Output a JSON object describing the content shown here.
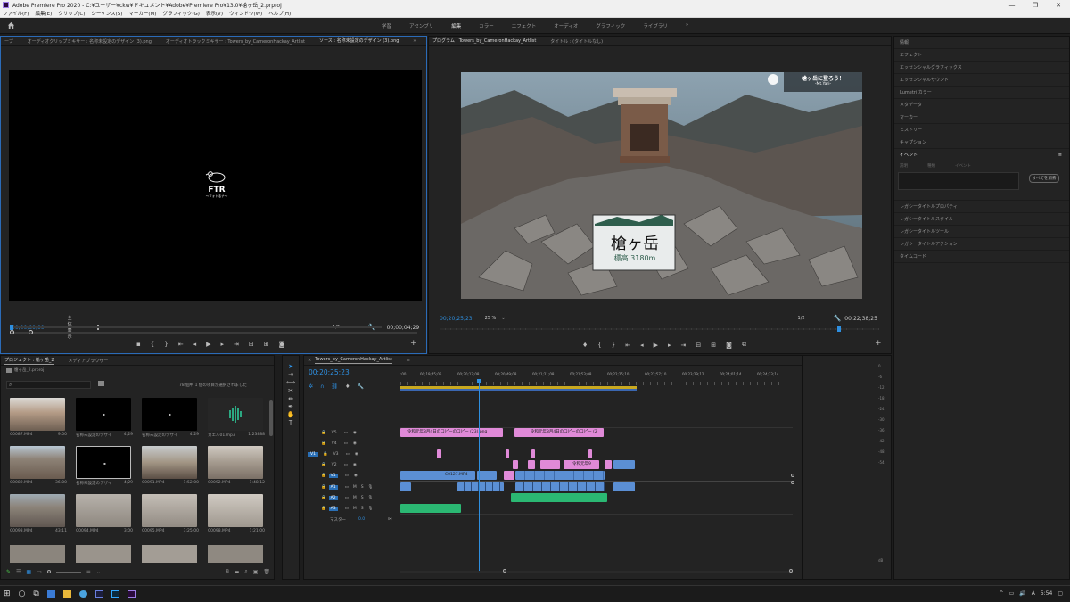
{
  "window": {
    "title": "Adobe Premiere Pro 2020 - C:¥ユーザー¥ckw¥ドキュメント¥Adobe¥Premiere Pro¥13.0¥槍ヶ岳_2.prproj",
    "minimize": "—",
    "maximize": "❐",
    "close": "✕"
  },
  "menu": [
    "ファイル(F)",
    "編集(E)",
    "クリップ(C)",
    "シーケンス(S)",
    "マーカー(M)",
    "グラフィック(G)",
    "表示(V)",
    "ウィンドウ(W)",
    "ヘルプ(H)"
  ],
  "workspace": {
    "tabs": [
      "学習",
      "アセンブリ",
      "編集",
      "カラー",
      "エフェクト",
      "オーディオ",
      "グラフィック",
      "ライブラリ"
    ],
    "active": "編集",
    "more": "»"
  },
  "source": {
    "tabs": [
      "ープ",
      "オーディオクリップミキサー : 名称未設定のデザイン (3).png",
      "オーディオトラックミキサー : Towers_by_CameronHackay_Artlist",
      "ソース : 名称未設定のデザイン (3).png"
    ],
    "expand": "»",
    "logo_text": "FTR",
    "logo_sub": "〜フォトるナ〜",
    "timecode_in": "00;00;00;00",
    "fit": "全体表示",
    "ratio": "1/2",
    "duration": "00;00;04;29"
  },
  "program": {
    "tabs": [
      "プログラム : Towers_by_CameronHackay_Artlist",
      "タイトル : (タイトルなし)"
    ],
    "sign_name": "槍ヶ岳",
    "sign_sub": "標高 3180m",
    "overlay_title": "槍ヶ岳に登ろう！",
    "overlay_sub": "-Mt.Yari-",
    "timecode": "00;20;25;23",
    "zoom": "25 %",
    "ratio": "1/2",
    "duration": "00;22;38;25"
  },
  "right_panel": {
    "items": [
      "情報",
      "エフェクト",
      "エッセンシャルグラフィックス",
      "エッセンシャルサウンド",
      "Lumetri カラー",
      "メタデータ",
      "マーカー",
      "ヒストリー",
      "キャプション",
      "イベント"
    ],
    "events_cols": [
      "説明",
      "種類",
      "イベント"
    ],
    "clear_all": "すべてを消去",
    "legacy": [
      "レガシータイトルプロパティ",
      "レガシータイトルスタイル",
      "レガシータイトルツール",
      "レガシータイトルアクション",
      "タイムコード"
    ]
  },
  "project": {
    "tabs": [
      "プロジェクト : 槍ヶ岳_2",
      "メディアブラウザー"
    ],
    "file": "槍ヶ岳_2.prproj",
    "status": "78 個中 1 個の項目が選択されました",
    "clips": [
      {
        "name": "C0087.MP4",
        "dur": "9:00"
      },
      {
        "name": "名称未設定のデザイ",
        "dur": "4;29"
      },
      {
        "name": "名称未設定のデザイ",
        "dur": "4;29"
      },
      {
        "name": "カエル01.mp3",
        "dur": "1:23888"
      },
      {
        "name": "C0089.MP4",
        "dur": "36:00"
      },
      {
        "name": "名称未設定のデザイ",
        "dur": "4;29"
      },
      {
        "name": "C0091.MP4",
        "dur": "1:52:00"
      },
      {
        "name": "C0092.MP4",
        "dur": "1:48:12"
      },
      {
        "name": "C0093.MP4",
        "dur": "43:11"
      },
      {
        "name": "C0094.MP4",
        "dur": "3:00"
      },
      {
        "name": "C0095.MP4",
        "dur": "3:25:00"
      },
      {
        "name": "C0098.MP4",
        "dur": "1:21:00"
      }
    ]
  },
  "timeline": {
    "tab": "Towers_by_CameronHackay_Artlist",
    "timecode": "00;20;25;23",
    "ruler": [
      ":00",
      "00;19;45;05",
      "00;20;17;08",
      "00;20;49;08",
      "00;21;21;08",
      "00;21;53;08",
      "00;22;25;10",
      "00;22;57;10",
      "00;23;29;12",
      "00;24;01;14",
      "00;24;33;14"
    ],
    "tracks": [
      "V5",
      "V4",
      "V3",
      "V2",
      "V1",
      "A1",
      "A2",
      "A3"
    ],
    "master": "マスター",
    "master_val": "0.0",
    "clip_labels": {
      "v5a": "令和元年8月4日のコピーのコピー (23).png",
      "v5b": "令和元年8月4日のコピーのコピー (2",
      "v2": "令和元年9",
      "v1": "C0127.MP4"
    }
  },
  "meter": {
    "labels": [
      "0",
      "-6",
      "-12",
      "-18",
      "-24",
      "-30",
      "-36",
      "-42",
      "-48",
      "-54"
    ],
    "db": "dB"
  },
  "taskbar": {
    "time": "5:54"
  }
}
